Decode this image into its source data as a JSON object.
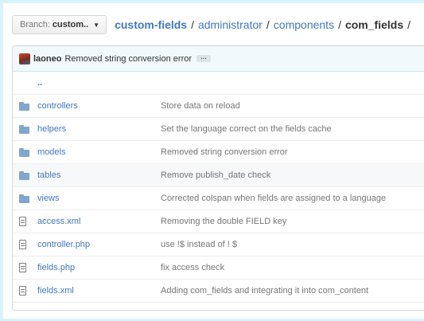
{
  "branch": {
    "label": "Branch:",
    "name": "custom.."
  },
  "breadcrumb": {
    "repo": "custom-fields",
    "sep": "/",
    "parts": [
      "administrator",
      "components"
    ],
    "current": "com_fields"
  },
  "commit": {
    "author": "laoneo",
    "message": "Removed string conversion error",
    "ellipsis": "…"
  },
  "parent_link": "..",
  "files": [
    {
      "name": "controllers",
      "type": "folder",
      "message": "Store data on reload"
    },
    {
      "name": "helpers",
      "type": "folder",
      "message": "Set the language correct on the fields cache"
    },
    {
      "name": "models",
      "type": "folder",
      "message": "Removed string conversion error"
    },
    {
      "name": "tables",
      "type": "folder",
      "message": "Remove publish_date check"
    },
    {
      "name": "views",
      "type": "folder",
      "message": "Corrected colspan when fields are assigned to a language"
    },
    {
      "name": "access.xml",
      "type": "file",
      "message": "Removing the double FIELD key"
    },
    {
      "name": "controller.php",
      "type": "file",
      "message": "use !$ instead of ! $"
    },
    {
      "name": "fields.php",
      "type": "file",
      "message": "fix access check"
    },
    {
      "name": "fields.xml",
      "type": "file",
      "message": "Adding com_fields and integrating it into com_content"
    }
  ],
  "icons": {
    "folder": "folder-icon",
    "file": "file-text-icon",
    "caret": "caret-down-icon"
  },
  "colors": {
    "link": "#4078c0",
    "page_bg": "#d7f4fc",
    "commit_bg": "#f2f9fc"
  }
}
